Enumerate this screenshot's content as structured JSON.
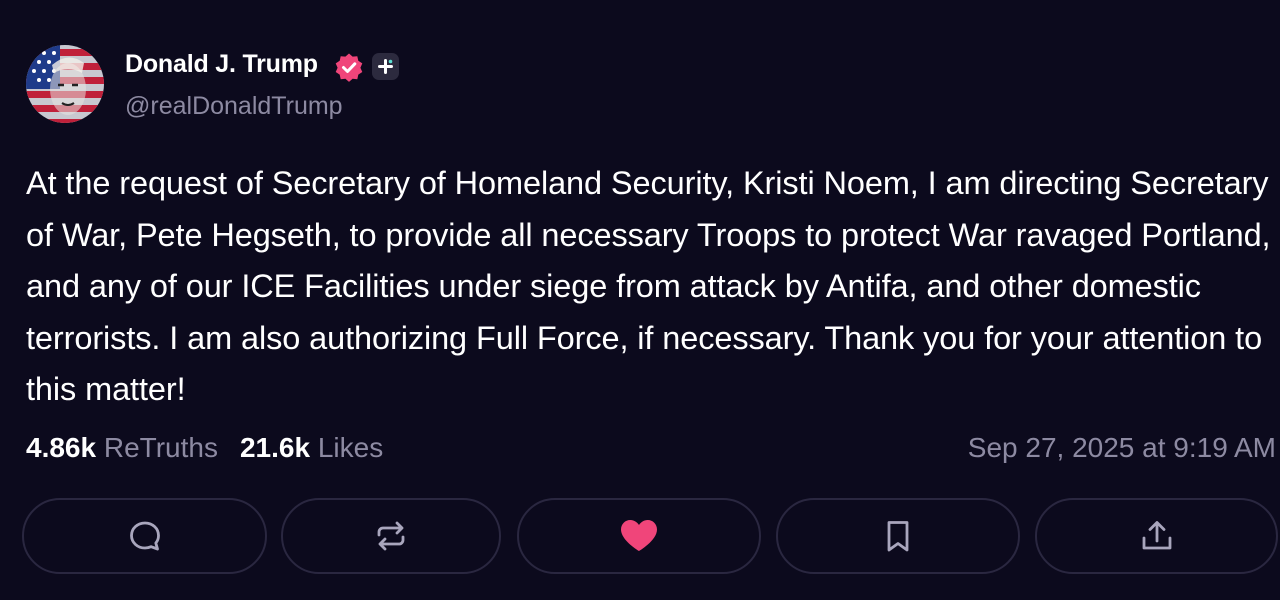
{
  "author": {
    "name": "Donald J. Trump",
    "handle": "@realDonaldTrump"
  },
  "post": {
    "text": "At the request of Secretary of Homeland Security, Kristi Noem, I am directing Secretary of War, Pete Hegseth, to provide all necessary Troops to protect War ravaged Portland, and any of our ICE Facilities under siege from attack by Antifa, and other domestic terrorists. I am also authorizing Full Force, if necessary. Thank you for your attention to this matter!",
    "retruths_count": "4.86k",
    "retruths_label": "ReTruths",
    "likes_count": "21.6k",
    "likes_label": "Likes",
    "timestamp": "Sep 27, 2025 at 9:19 AM"
  },
  "actions": [
    {
      "icon": "reply-icon"
    },
    {
      "icon": "retruth-icon"
    },
    {
      "icon": "heart-icon"
    },
    {
      "icon": "bookmark-icon"
    },
    {
      "icon": "share-icon"
    }
  ],
  "colors": {
    "background": "#0c0a1d",
    "muted_text": "#8d8aa2",
    "verified_badge": "#f0457a",
    "like_active": "#f0457a",
    "button_border": "#2a2740"
  }
}
